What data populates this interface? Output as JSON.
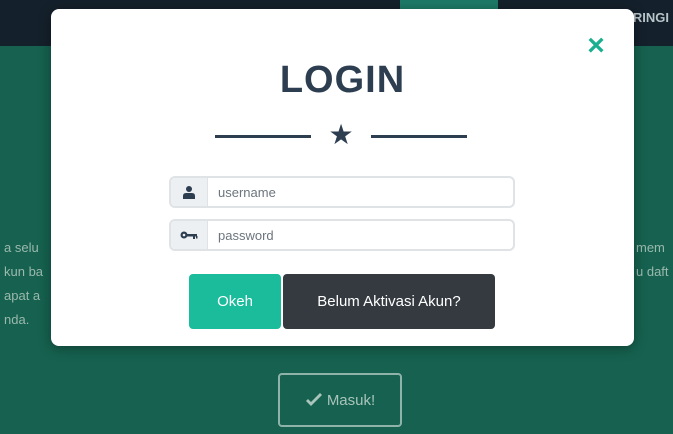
{
  "background": {
    "topbar_text": "RINGI",
    "left_text_lines": [
      "a selu",
      "kun ba",
      "apat a",
      "nda."
    ],
    "right_text_lines": [
      "mem",
      "u daft"
    ],
    "masuk_button": {
      "label": "Masuk!",
      "icon": "hand-icon"
    }
  },
  "modal": {
    "close_icon": "×",
    "title": "LOGIN",
    "divider_star": "★",
    "username": {
      "placeholder": "username",
      "value": "",
      "icon": "user-icon"
    },
    "password": {
      "placeholder": "password",
      "value": "",
      "icon": "key-icon"
    },
    "buttons": {
      "submit_label": "Okeh",
      "activation_label": "Belum Aktivasi Akun?"
    }
  },
  "colors": {
    "accent": "#1abc9c",
    "dark": "#343a40",
    "title": "#2c3e50",
    "background": "#16614f"
  }
}
